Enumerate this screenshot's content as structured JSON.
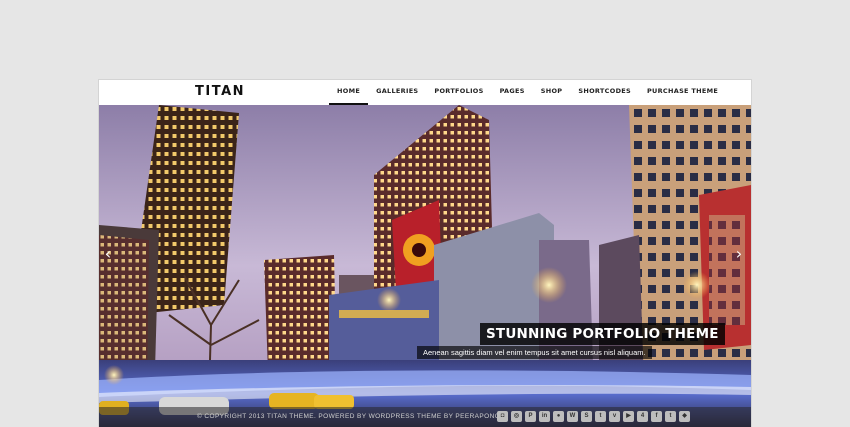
{
  "header": {
    "logo": "TITAN",
    "nav": [
      "HOME",
      "GALLERIES",
      "PORTFOLIOS",
      "PAGES",
      "SHOP",
      "SHORTCODES",
      "PURCHASE THEME"
    ],
    "active": "HOME"
  },
  "slider": {
    "title": "STUNNING PORTFOLIO THEME",
    "subtitle": "Aenean sagittis diam vel enim tempus sit amet cursus nisl aliquam.",
    "prev_icon": "‹",
    "next_icon": "›"
  },
  "footer": {
    "copyright": "© COPYRIGHT 2013 TITAN THEME. POWERED BY WORDPRESS THEME BY PEERAPONG",
    "social_icons": [
      "instagram-icon",
      "dribbble-icon",
      "pinterest-icon",
      "linkedin-icon",
      "flickr-icon",
      "wordpress-icon",
      "skype-icon",
      "tumblr-icon",
      "vimeo-icon",
      "youtube-icon",
      "foursquare-icon",
      "facebook-icon",
      "twitter-icon",
      "apple-icon"
    ]
  },
  "colors": {
    "accent": "#111111",
    "background": "#e6e6e6"
  }
}
